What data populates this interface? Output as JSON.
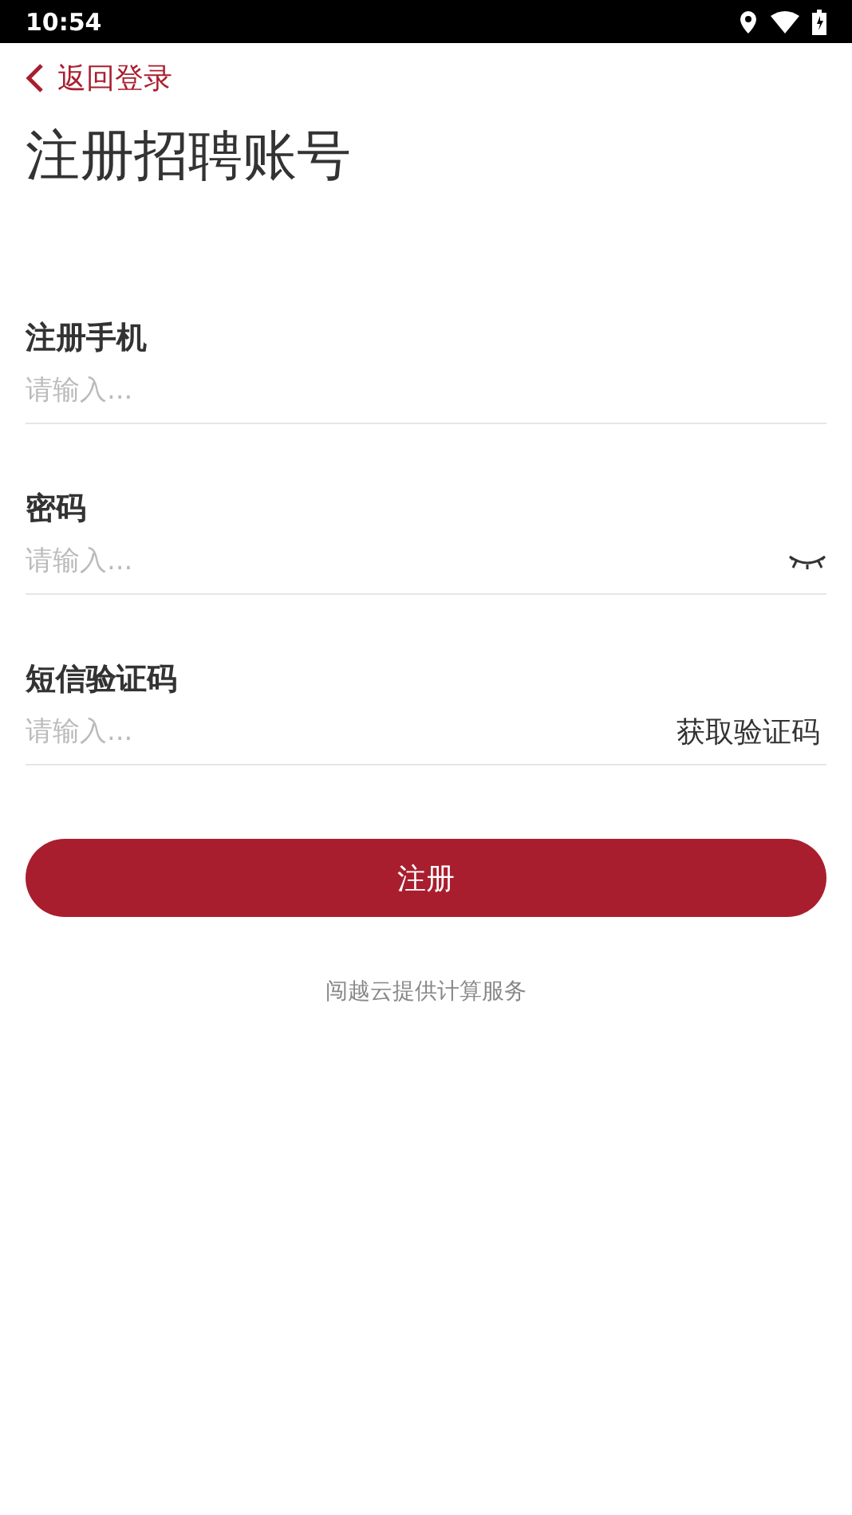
{
  "status_bar": {
    "time": "10:54"
  },
  "back_link": {
    "label": "返回登录"
  },
  "title": "注册招聘账号",
  "fields": [
    {
      "kind": "plain",
      "label": "注册手机",
      "placeholder": "请输入..."
    },
    {
      "kind": "password",
      "label": "密码",
      "placeholder": "请输入..."
    },
    {
      "kind": "code",
      "label": "短信验证码",
      "placeholder": "请输入...",
      "action": "获取验证码"
    }
  ],
  "submit_button": "注册",
  "footer": "闯越云提供计算服务"
}
